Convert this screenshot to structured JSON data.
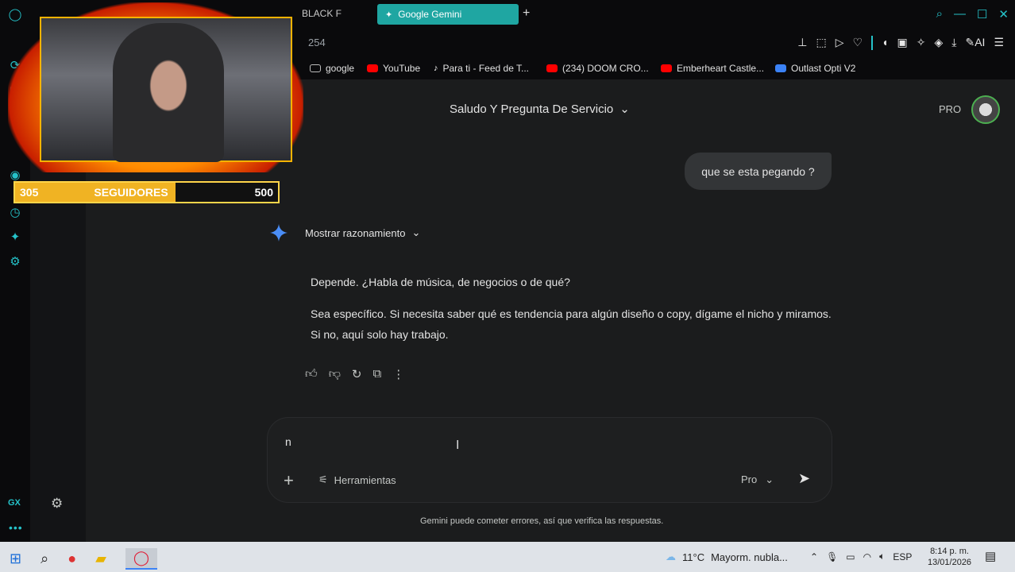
{
  "browser": {
    "tab_partial": "BLACK F",
    "active_tab": "Google Gemini",
    "address_partial": "254",
    "colors": {
      "accent": "#25c2c9",
      "tab_active": "#1fa6a2"
    }
  },
  "bookmarks": [
    {
      "label": "google",
      "icon": "folder-icon"
    },
    {
      "label": "YouTube",
      "icon": "youtube-icon"
    },
    {
      "label": "Para ti - Feed de T...",
      "icon": "tiktok-icon"
    },
    {
      "label": "(234) DOOM CRO...",
      "icon": "youtube-icon"
    },
    {
      "label": "Emberheart Castle...",
      "icon": "youtube-icon"
    },
    {
      "label": "Outlast Opti V2",
      "icon": "edge-icon"
    }
  ],
  "gemini": {
    "conversation_title": "Saludo Y Pregunta De Servicio",
    "plan_badge": "PRO",
    "user_message": "que se esta pegando ?",
    "show_reasoning": "Mostrar razonamiento",
    "response": [
      "Depende. ¿Habla de música, de negocios o de qué?",
      "Sea específico. Si necesita saber qué es tendencia para algún diseño o copy, dígame el nicho y miramos. Si no, aquí solo hay trabajo."
    ],
    "composer": {
      "typed_text": "n",
      "tools_label": "Herramientas",
      "model_label": "Pro"
    },
    "disclaimer": "Gemini puede cometer errores, así que verifica las respuestas."
  },
  "stream": {
    "followers_current": "305",
    "followers_label": "SEGUIDORES",
    "followers_goal": "500",
    "progress_fraction": 0.61
  },
  "taskbar": {
    "weather_temp": "11°C",
    "weather_text": "Mayorm. nubla...",
    "language": "ESP",
    "time": "8:14 p. m.",
    "date": "13/01/2026"
  }
}
